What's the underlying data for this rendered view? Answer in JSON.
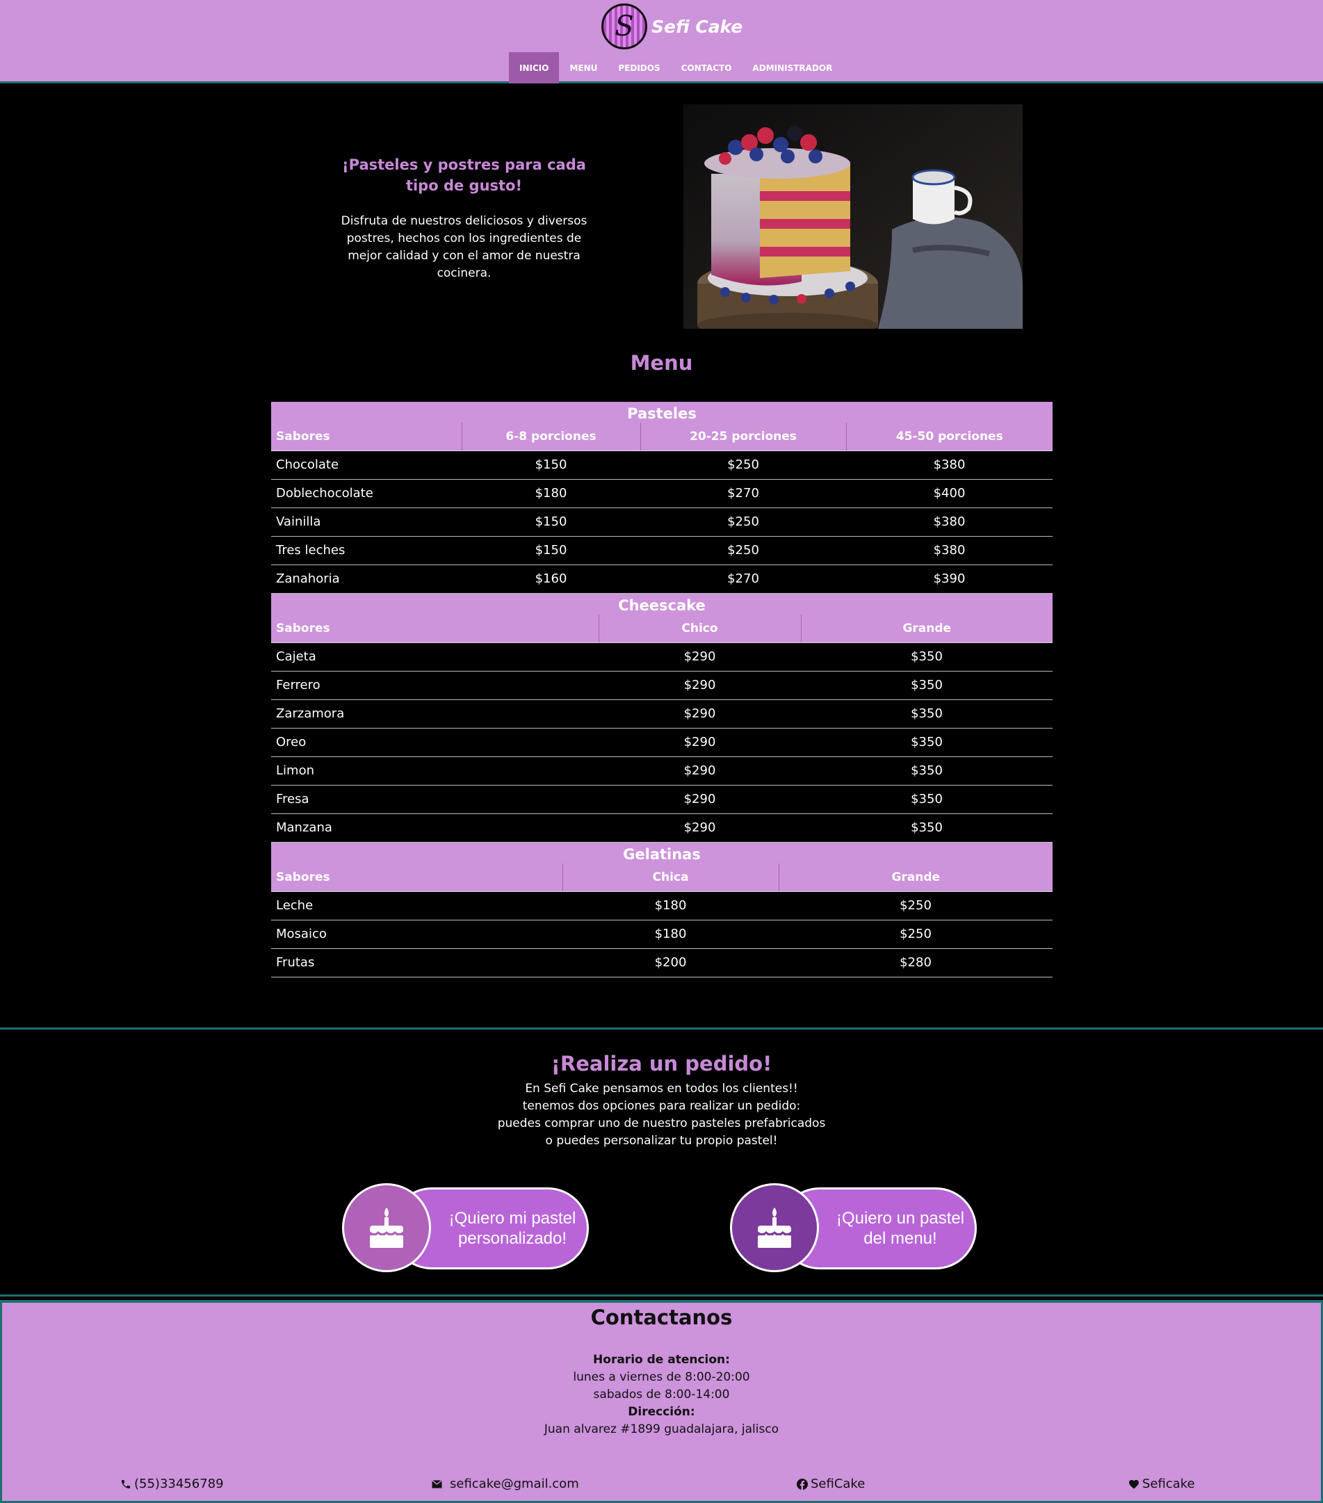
{
  "brand": {
    "logo_letter": "S",
    "name": "Sefi Cake"
  },
  "nav": [
    {
      "label": "INICIO",
      "active": true
    },
    {
      "label": "MENU"
    },
    {
      "label": "PEDIDOS"
    },
    {
      "label": "CONTACTO"
    },
    {
      "label": "ADMINISTRADOR"
    }
  ],
  "hero": {
    "title": "¡Pasteles y postres para cada tipo de gusto!",
    "text": "Disfruta de nuestros deliciosos y diversos postres, hechos con los ingredientes de mejor calidad y con el amor de nuestra cocinera."
  },
  "menu": {
    "title": "Menu",
    "pasteles": {
      "caption": "Pasteles",
      "headers": [
        "Sabores",
        "6-8 porciones",
        "20-25 porciones",
        "45-50 porciones"
      ],
      "rows": [
        [
          "Chocolate",
          "$150",
          "$250",
          "$380"
        ],
        [
          "Doblechocolate",
          "$180",
          "$270",
          "$400"
        ],
        [
          "Vainilla",
          "$150",
          "$250",
          "$380"
        ],
        [
          "Tres leches",
          "$150",
          "$250",
          "$380"
        ],
        [
          "Zanahoria",
          "$160",
          "$270",
          "$390"
        ]
      ]
    },
    "cheescake": {
      "caption": "Cheescake",
      "headers": [
        "Sabores",
        "Chico",
        "Grande"
      ],
      "rows": [
        [
          "Cajeta",
          "$290",
          "$350"
        ],
        [
          "Ferrero",
          "$290",
          "$350"
        ],
        [
          "Zarzamora",
          "$290",
          "$350"
        ],
        [
          "Oreo",
          "$290",
          "$350"
        ],
        [
          "Limon",
          "$290",
          "$350"
        ],
        [
          "Fresa",
          "$290",
          "$350"
        ],
        [
          "Manzana",
          "$290",
          "$350"
        ]
      ]
    },
    "gelatinas": {
      "caption": "Gelatinas",
      "headers": [
        "Sabores",
        "Chica",
        "Grande"
      ],
      "rows": [
        [
          "Leche",
          "$180",
          "$250"
        ],
        [
          "Mosaico",
          "$180",
          "$250"
        ],
        [
          "Frutas",
          "$200",
          "$280"
        ]
      ]
    }
  },
  "order": {
    "title": "¡Realiza un pedido!",
    "lines": [
      "En Sefi Cake pensamos en todos los clientes!!",
      "tenemos dos opciones para realizar un pedido:",
      "puedes comprar uno de nuestro pasteles prefabricados",
      "o puedes personalizar tu propio pastel!"
    ],
    "custom_button": "¡Quiero mi pastel personalizado!",
    "menu_button": "¡Quiero un pastel del menu!"
  },
  "footer": {
    "title": "Contactanos",
    "hours_label": "Horario de atencion:",
    "hours_weekday": "lunes a viernes de 8:00-20:00",
    "hours_saturday": "sabados de 8:00-14:00",
    "address_label": "Dirección:",
    "address": "Juan alvarez #1899 guadalajara, jalisco",
    "phone": "(55)33456789",
    "email": "seficake@gmail.com",
    "facebook": "SefiCake",
    "instagram": "Seficake"
  },
  "colors": {
    "header_bg": "#cd93db",
    "accent_text": "#c889d8",
    "button_pill": "#b965d8",
    "button_circle_1": "#b061b8",
    "button_circle_2": "#7c3a9c",
    "divider": "#1d6f6f"
  },
  "icons": [
    "phone-icon",
    "email-icon",
    "facebook-icon",
    "heart-icon",
    "cake-icon"
  ]
}
